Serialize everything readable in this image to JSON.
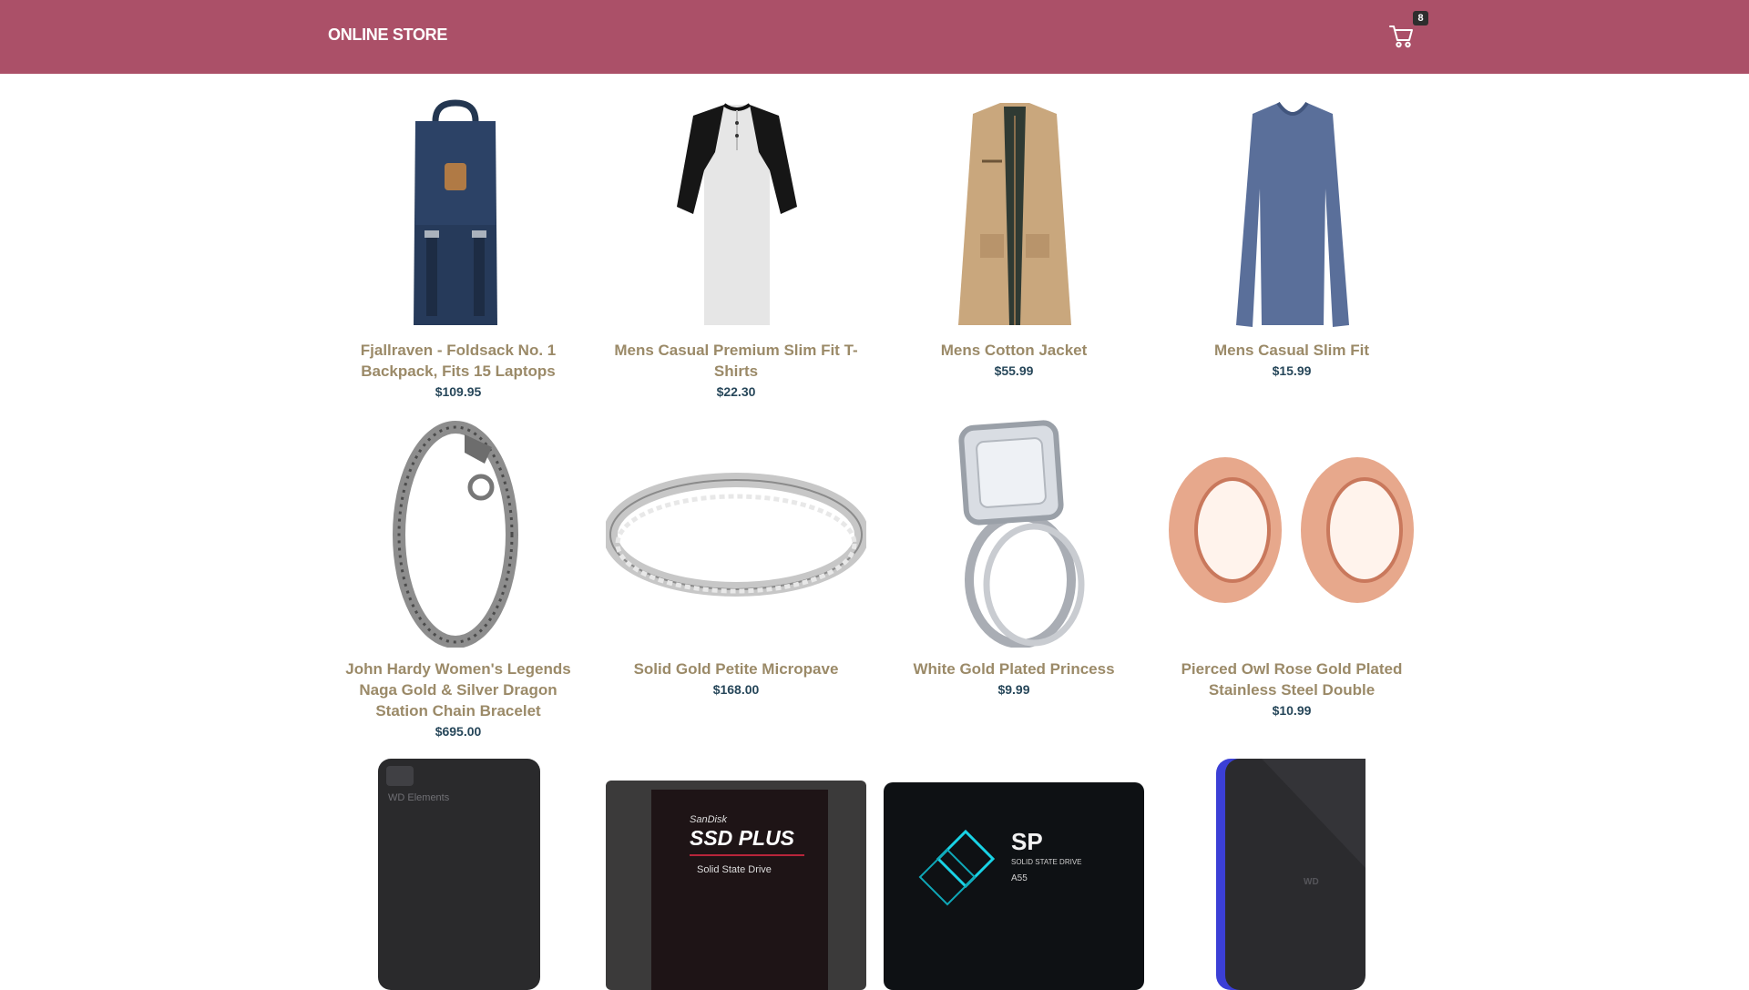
{
  "header": {
    "brand": "ONLINE STORE",
    "cart_icon": "shopping-cart-icon",
    "cart_count": "8"
  },
  "colors": {
    "header_bg": "#ab5068",
    "title": "#9b8a68",
    "price": "#27475a"
  },
  "products": [
    {
      "title": "Fjallraven - Foldsack No. 1 Backpack, Fits 15 Laptops",
      "price": "$109.95",
      "image": "backpack"
    },
    {
      "title": "Mens Casual Premium Slim Fit T-Shirts",
      "price": "$22.30",
      "image": "raglan-tshirt"
    },
    {
      "title": "Mens Cotton Jacket",
      "price": "$55.99",
      "image": "cotton-jacket"
    },
    {
      "title": "Mens Casual Slim Fit",
      "price": "$15.99",
      "image": "long-sleeve-shirt"
    },
    {
      "title": "John Hardy Women's Legends Naga Gold & Silver Dragon Station Chain Bracelet",
      "price": "$695.00",
      "image": "dragon-bracelet"
    },
    {
      "title": "Solid Gold Petite Micropave",
      "price": "$168.00",
      "image": "silver-ring"
    },
    {
      "title": "White Gold Plated Princess",
      "price": "$9.99",
      "image": "diamond-ring"
    },
    {
      "title": "Pierced Owl Rose Gold Plated Stainless Steel Double",
      "price": "$10.99",
      "image": "rose-gold-tunnels"
    },
    {
      "title": "",
      "price": "",
      "image": "wd-external-drive",
      "image_text": "WD Elements"
    },
    {
      "title": "",
      "price": "",
      "image": "sandisk-ssd",
      "image_text": [
        "SanDisk",
        "SSD PLUS",
        "Solid State Drive"
      ]
    },
    {
      "title": "",
      "price": "",
      "image": "silicon-power-ssd",
      "image_text": [
        "SP",
        "SOLID STATE DRIVE",
        "A55"
      ]
    },
    {
      "title": "",
      "price": "",
      "image": "wd-gaming-drive",
      "image_text": "WD"
    }
  ]
}
